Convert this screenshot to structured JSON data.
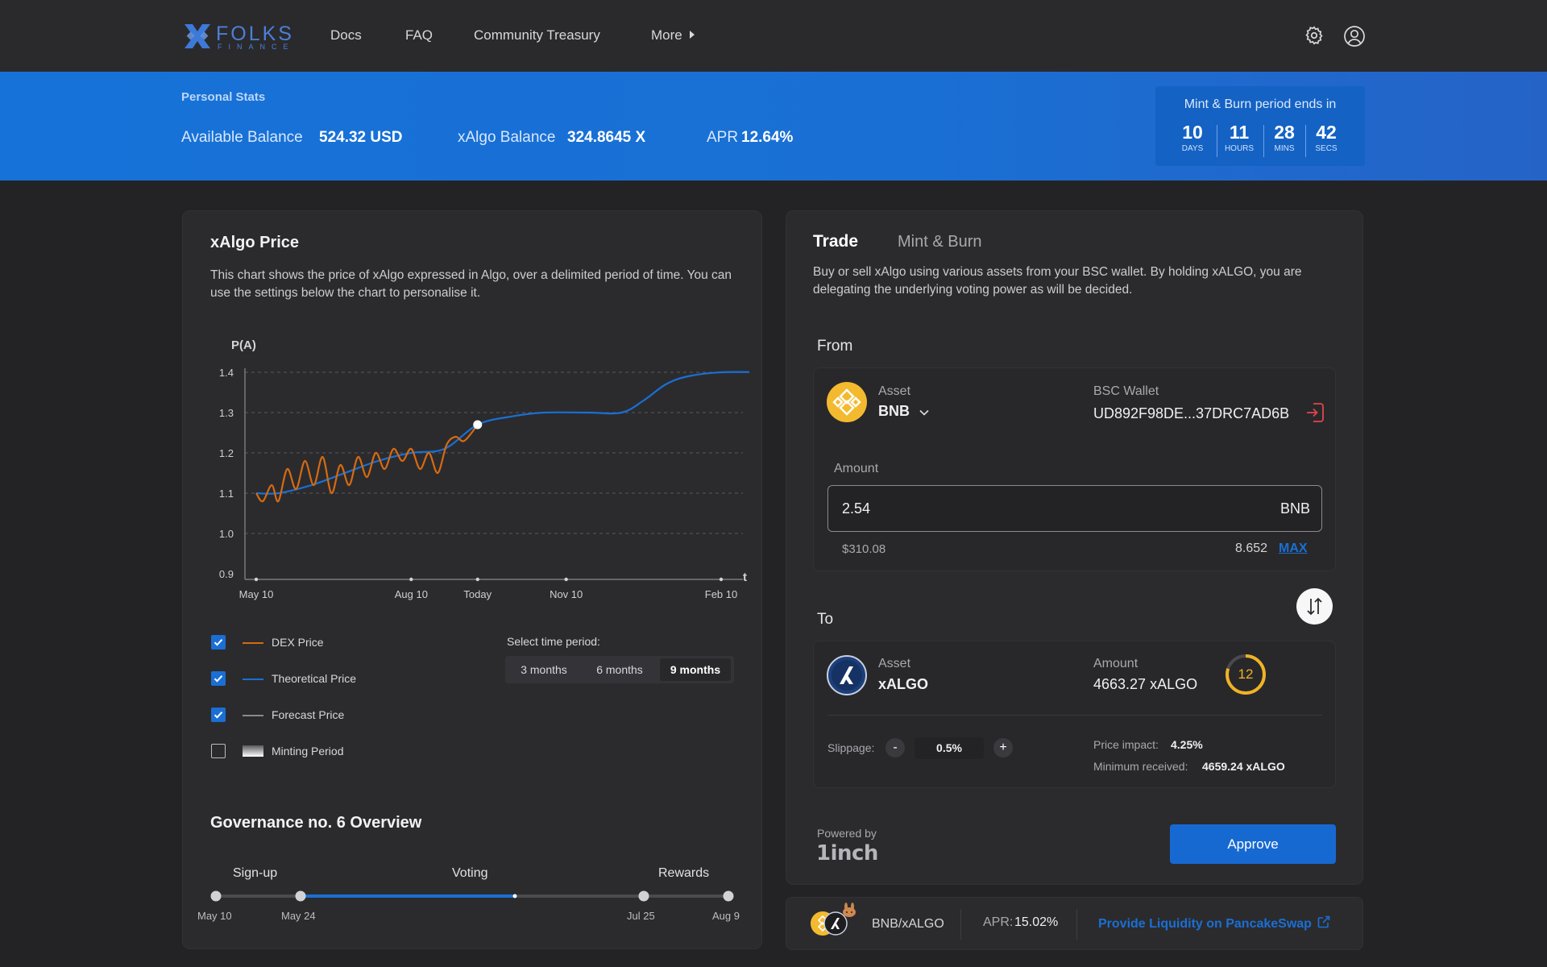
{
  "nav": {
    "logo_text": "FOLKS",
    "logo_sub": "FINANCE",
    "links": [
      "Docs",
      "FAQ",
      "Community Treasury",
      "More"
    ]
  },
  "stats": {
    "title": "Personal Stats",
    "available_balance_label": "Available Balance",
    "available_balance_value": "524.32 USD",
    "xalgo_balance_label": "xAlgo Balance",
    "xalgo_balance_value": "324.8645 X",
    "apr_label": "APR",
    "apr_value": "12.64%"
  },
  "countdown": {
    "title": "Mint & Burn period ends in",
    "days": "10",
    "days_label": "DAYS",
    "hours": "11",
    "hours_label": "HOURS",
    "mins": "28",
    "mins_label": "MINS",
    "secs": "42",
    "secs_label": "SECS"
  },
  "price_card": {
    "title": "xAlgo Price",
    "description": "This chart shows the price of xAlgo expressed in Algo, over a delimited period of time. You can use the settings below the chart to personalise it.",
    "legend": [
      {
        "label": "DEX Price",
        "checked": true,
        "color": "#d66a10"
      },
      {
        "label": "Theoretical Price",
        "checked": true,
        "color": "#1a6fd4"
      },
      {
        "label": "Forecast Price",
        "checked": true,
        "color": "#8a8a8f"
      },
      {
        "label": "Minting Period",
        "checked": false,
        "color": "#ffffff"
      }
    ],
    "period_label": "Select time period:",
    "periods": [
      "3 months",
      "6 months",
      "9 months"
    ],
    "selected_period": "9 months"
  },
  "chart_data": {
    "type": "line",
    "ylabel": "P(A)",
    "xlabel": "t",
    "ylim": [
      0.9,
      1.4
    ],
    "yticks": [
      "1.4",
      "1.3",
      "1.2",
      "1.1",
      "1.0",
      "0.9"
    ],
    "xticks": [
      "May 10",
      "Aug 10",
      "Today",
      "Nov 10",
      "Feb 10"
    ],
    "grid": true,
    "series": [
      {
        "name": "DEX Price",
        "color": "#d66a10",
        "points": [
          [
            0,
            1.1
          ],
          [
            0.03,
            1.08
          ],
          [
            0.07,
            1.12
          ],
          [
            0.1,
            1.08
          ],
          [
            0.14,
            1.16
          ],
          [
            0.18,
            1.11
          ],
          [
            0.22,
            1.18
          ],
          [
            0.26,
            1.12
          ],
          [
            0.3,
            1.19
          ],
          [
            0.34,
            1.1
          ],
          [
            0.38,
            1.17
          ],
          [
            0.42,
            1.12
          ],
          [
            0.46,
            1.19
          ],
          [
            0.5,
            1.14
          ],
          [
            0.54,
            1.2
          ],
          [
            0.58,
            1.16
          ],
          [
            0.62,
            1.21
          ],
          [
            0.66,
            1.18
          ],
          [
            0.7,
            1.21
          ],
          [
            0.74,
            1.16
          ],
          [
            0.78,
            1.2
          ],
          [
            0.82,
            1.15
          ],
          [
            0.86,
            1.22
          ],
          [
            0.9,
            1.24
          ],
          [
            0.94,
            1.23
          ],
          [
            1.0,
            1.27
          ]
        ]
      },
      {
        "name": "Theoretical Price",
        "color": "#1a6fd4",
        "points": [
          [
            0,
            1.1
          ],
          [
            0.1,
            1.1
          ],
          [
            0.25,
            1.12
          ],
          [
            0.4,
            1.15
          ],
          [
            0.55,
            1.18
          ],
          [
            0.7,
            1.2
          ],
          [
            0.85,
            1.21
          ],
          [
            1.0,
            1.27
          ],
          [
            1.15,
            1.29
          ],
          [
            1.3,
            1.3
          ],
          [
            1.5,
            1.3
          ],
          [
            1.65,
            1.3
          ],
          [
            1.75,
            1.33
          ],
          [
            1.85,
            1.37
          ],
          [
            1.95,
            1.39
          ],
          [
            2.1,
            1.4
          ],
          [
            2.3,
            1.4
          ]
        ]
      }
    ],
    "today_point": [
      1.0,
      1.27
    ]
  },
  "governance": {
    "title": "Governance no. 6 Overview",
    "phases": [
      "Sign-up",
      "Voting",
      "Rewards"
    ],
    "dates": [
      "May 10",
      "May 24",
      "Jul 25",
      "Aug 9"
    ],
    "progress": 0.62
  },
  "trade": {
    "tabs": [
      "Trade",
      "Mint & Burn"
    ],
    "description": "Buy or sell xAlgo using various assets from your BSC wallet. By holding xALGO, you are delegating the underlying voting power as will be decided.",
    "from": {
      "title": "From",
      "asset_label": "Asset",
      "asset_value": "BNB",
      "wallet_label": "BSC Wallet",
      "wallet_value": "UD892F98DE...37DRC7AD6B",
      "amount_label": "Amount",
      "amount_value": "2.54",
      "amount_unit": "BNB",
      "usd_value": "$310.08",
      "balance": "8.652",
      "max_label": "MAX"
    },
    "to": {
      "title": "To",
      "asset_label": "Asset",
      "asset_value": "xALGO",
      "amount_label": "Amount",
      "amount_value": "4663.27 xALGO",
      "refresh_counter": "12",
      "refresh_fraction": 0.8,
      "slippage_label": "Slippage:",
      "slippage_minus": "-",
      "slippage_value": "0.5%",
      "slippage_plus": "+",
      "price_impact_label": "Price impact:",
      "price_impact_value": "4.25%",
      "min_received_label": "Minimum received:",
      "min_received_value": "4659.24 xALGO"
    },
    "powered_by_label": "Powered by",
    "powered_by_value": "1inch",
    "approve_label": "Approve"
  },
  "pool": {
    "pair": "BNB/xALGO",
    "apr_label": "APR:",
    "apr_value": "15.02%",
    "link_label": "Provide Liquidity on PancakeSwap"
  },
  "colors": {
    "accent": "#1a6fd4",
    "dex": "#d66a10",
    "bnb": "#f3ba2f",
    "counter": "#f0b323",
    "wallet_icon": "#e0454b"
  }
}
